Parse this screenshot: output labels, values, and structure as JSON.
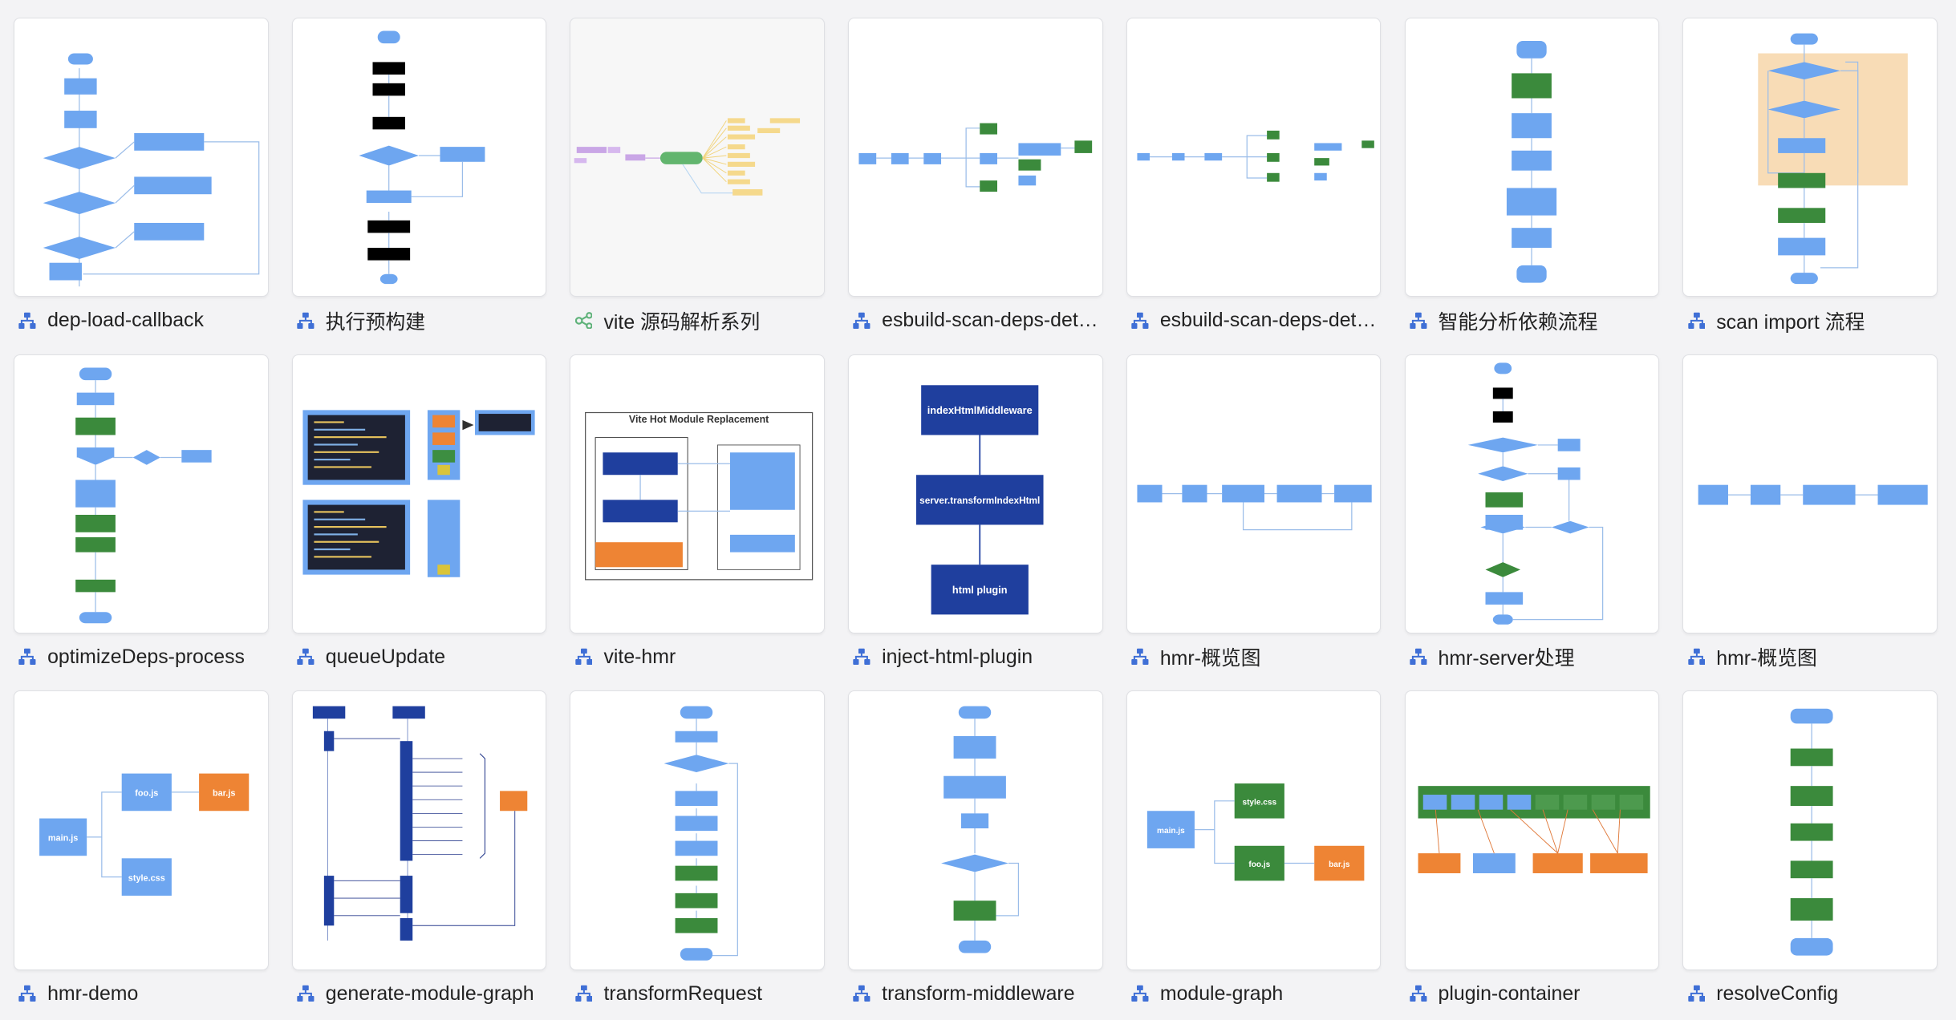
{
  "files": [
    {
      "title": "dep-load-callback",
      "icon": "flowchart-icon",
      "thumb": "flow-decisions"
    },
    {
      "title": "执行预构建",
      "icon": "flowchart-icon",
      "thumb": "flow-branch"
    },
    {
      "title": "vite 源码解析系列",
      "icon": "mindmap-icon",
      "thumb": "mindmap"
    },
    {
      "title": "esbuild-scan-deps-details",
      "icon": "flowchart-icon",
      "thumb": "horiz-tree"
    },
    {
      "title": "esbuild-scan-deps-details",
      "icon": "flowchart-icon",
      "thumb": "horiz-tree-light"
    },
    {
      "title": "智能分析依赖流程",
      "icon": "flowchart-icon",
      "thumb": "vertical-simple"
    },
    {
      "title": "scan import 流程",
      "icon": "flowchart-icon",
      "thumb": "loop-orange"
    },
    {
      "title": "optimizeDeps-process",
      "icon": "flowchart-icon",
      "thumb": "green-flow"
    },
    {
      "title": "queueUpdate",
      "icon": "flowchart-icon",
      "thumb": "code-blocks"
    },
    {
      "title": "vite-hmr",
      "icon": "flowchart-icon",
      "thumb": "hmr-diagram",
      "diagram_title": "Vite Hot Module Replacement"
    },
    {
      "title": "inject-html-plugin",
      "icon": "flowchart-icon",
      "thumb": "three-box",
      "boxes": [
        "indexHtmlMiddleware",
        "server.transformIndexHtml",
        "html plugin"
      ]
    },
    {
      "title": "hmr-概览图",
      "icon": "flowchart-icon",
      "thumb": "hmr-row-loop"
    },
    {
      "title": "hmr-server处理",
      "icon": "flowchart-icon",
      "thumb": "server-flow"
    },
    {
      "title": "hmr-概览图",
      "icon": "flowchart-icon",
      "thumb": "hmr-row"
    },
    {
      "title": "hmr-demo",
      "icon": "flowchart-icon",
      "thumb": "hmr-demo",
      "labels": [
        "main.js",
        "foo.js",
        "bar.js",
        "style.css"
      ]
    },
    {
      "title": "generate-module-graph",
      "icon": "flowchart-icon",
      "thumb": "sequence"
    },
    {
      "title": "transformRequest",
      "icon": "flowchart-icon",
      "thumb": "transform-request"
    },
    {
      "title": "transform-middleware",
      "icon": "flowchart-icon",
      "thumb": "transform-middleware"
    },
    {
      "title": "module-graph",
      "icon": "flowchart-icon",
      "thumb": "module-graph",
      "labels": [
        "main.js",
        "style.css",
        "foo.js",
        "bar.js"
      ]
    },
    {
      "title": "plugin-container",
      "icon": "flowchart-icon",
      "thumb": "plugin-container"
    },
    {
      "title": "resolveConfig",
      "icon": "flowchart-icon",
      "thumb": "resolve-config"
    }
  ],
  "colors": {
    "blue": "#6ea6f0",
    "navy": "#1f3f9e",
    "green": "#3b8a3c",
    "orange": "#ee8434",
    "icon": "#3f6fd6",
    "mindmap": "#5fb27a"
  }
}
